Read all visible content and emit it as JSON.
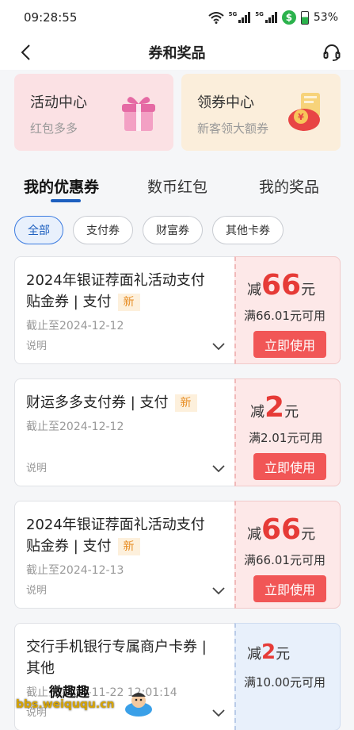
{
  "status_bar": {
    "time": "09:28:55",
    "battery": "53%",
    "network": "5G"
  },
  "nav": {
    "title": "券和奖品"
  },
  "promos": [
    {
      "title": "活动中心",
      "subtitle": "红包多多"
    },
    {
      "title": "领券中心",
      "subtitle": "新客领大额券"
    }
  ],
  "tabs": [
    "我的优惠券",
    "数币红包",
    "我的奖品"
  ],
  "chips": [
    "全部",
    "支付券",
    "财富券",
    "其他卡券"
  ],
  "coupons": [
    {
      "title_line1": "2024年银证荐面礼活动支付",
      "title_line2": "贴金券 | 支付",
      "badge": "新",
      "date": "截止至2024-12-12",
      "note": "说明",
      "prefix": "减",
      "amount": "66",
      "unit": "元",
      "condition": "满66.01元可用",
      "button": "立即使用"
    },
    {
      "title_line1": "财运多多支付券 | 支付",
      "badge": "新",
      "date": "截止至2024-12-12",
      "note": "说明",
      "prefix": "减",
      "amount": "2",
      "unit": "元",
      "condition": "满2.01元可用",
      "button": "立即使用"
    },
    {
      "title_line1": "2024年银证荐面礼活动支付",
      "title_line2": "贴金券 | 支付",
      "badge": "新",
      "date": "截止至2024-12-13",
      "note": "说明",
      "prefix": "减",
      "amount": "66",
      "unit": "元",
      "condition": "满66.01元可用",
      "button": "立即使用"
    },
    {
      "title_line1": "交行手机银行专属商户卡券 |",
      "title_line2": "其他",
      "date": "截止至2024-11-22 12:01:14",
      "note": "说明",
      "prefix": "减",
      "amount": "2",
      "unit": "元",
      "condition": "满10.00元可用"
    }
  ],
  "watermark": {
    "line1": "微趣趣",
    "line2": "bbs.weiququ.cn"
  },
  "colors": {
    "accent": "#e63b37",
    "tab_indicator": "#1d5fbf",
    "button": "#f15656"
  }
}
